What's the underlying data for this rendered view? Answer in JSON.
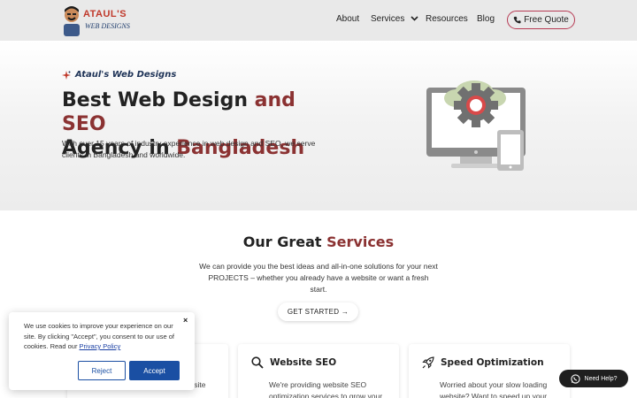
{
  "header": {
    "logo_line1": "ATAUL'S",
    "logo_line2": "WEB DESIGNS",
    "nav": [
      "About",
      "Services",
      "Resources",
      "Blog"
    ],
    "cta": "Free Quote",
    "cta_icon": "phone-icon"
  },
  "hero": {
    "tag": "Ataul's Web Designs",
    "title_part1": "Best Web Design ",
    "title_accent1": "and SEO",
    "title_line2a": "Agency in ",
    "title_accent2": "Bangladesh",
    "description": "With over 15 years of industry experience in web design and SEO, we serve clients in Bangladesh and worldwide."
  },
  "services": {
    "title_part1": "Our Great ",
    "title_accent": "Services",
    "description": "We can provide you the best ideas and all-in-one solutions for your next PROJECTS – whether you already have a website or want a fresh start.",
    "button": "GET STARTED →",
    "cards": [
      {
        "title": "",
        "icon": "",
        "text": "and conversion-focused website"
      },
      {
        "title": "Website SEO",
        "icon": "search-icon",
        "text": "We're providing website SEO optimization services to grow your"
      },
      {
        "title": "Speed Optimization",
        "icon": "rocket-icon",
        "text": "Worried about your slow loading website? Want to speed up your"
      }
    ]
  },
  "cookie": {
    "text": "We use cookies to improve your experience on our site. By clicking \"Accept\", you consent to our use of cookies. Read our ",
    "link": "Privacy Policy",
    "reject": "Reject",
    "accept": "Accept",
    "close": "×"
  },
  "help": {
    "label": "Need Help?",
    "icon": "whatsapp-icon"
  },
  "colors": {
    "accent": "#8b3232",
    "header_bg": "#e9e9e9",
    "cookie_button": "#1a4fa3",
    "cta_border": "#b73b54"
  }
}
